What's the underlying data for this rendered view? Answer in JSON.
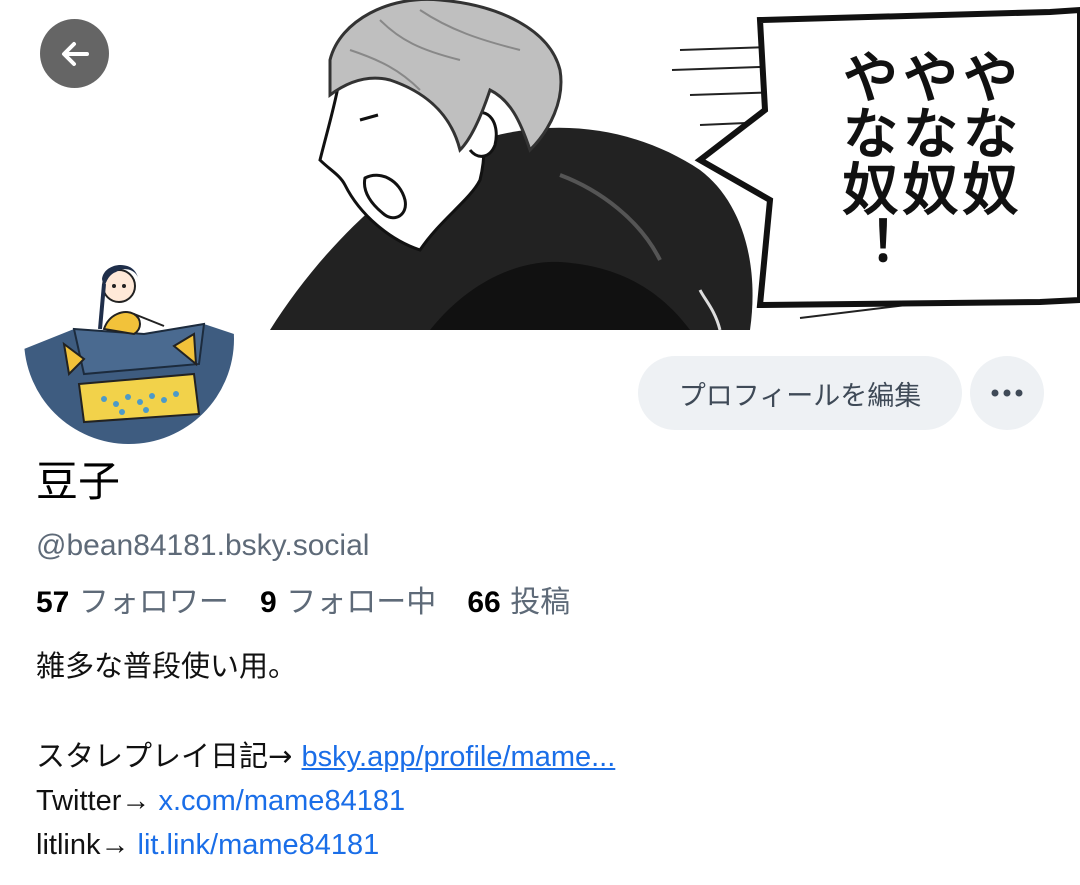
{
  "header": {
    "back_icon": "arrow-left-icon"
  },
  "banner": {
    "speech_text": [
      "やな奴",
      "やな奴",
      "やな奴！"
    ]
  },
  "profile": {
    "display_name": "豆子",
    "handle": "@bean84181.bsky.social",
    "edit_button_label": "プロフィールを編集",
    "more_icon": "ellipsis-icon",
    "stats": {
      "followers_count": "57",
      "followers_label": "フォロワー",
      "following_count": "9",
      "following_label": "フォロー中",
      "posts_count": "66",
      "posts_label": "投稿"
    },
    "bio": {
      "line1": "雑多な普段使い用。",
      "line2_prefix": "スタレプレイ日記→ ",
      "line2_link": "bsky.app/profile/mame...",
      "line3_prefix": "Twitter→ ",
      "line3_link": "x.com/mame84181",
      "line4_prefix": "litlink→ ",
      "line4_link": "lit.link/mame84181"
    }
  },
  "colors": {
    "link": "#1a6ee8",
    "muted": "#5e6a78",
    "button_bg": "#eef1f4"
  }
}
